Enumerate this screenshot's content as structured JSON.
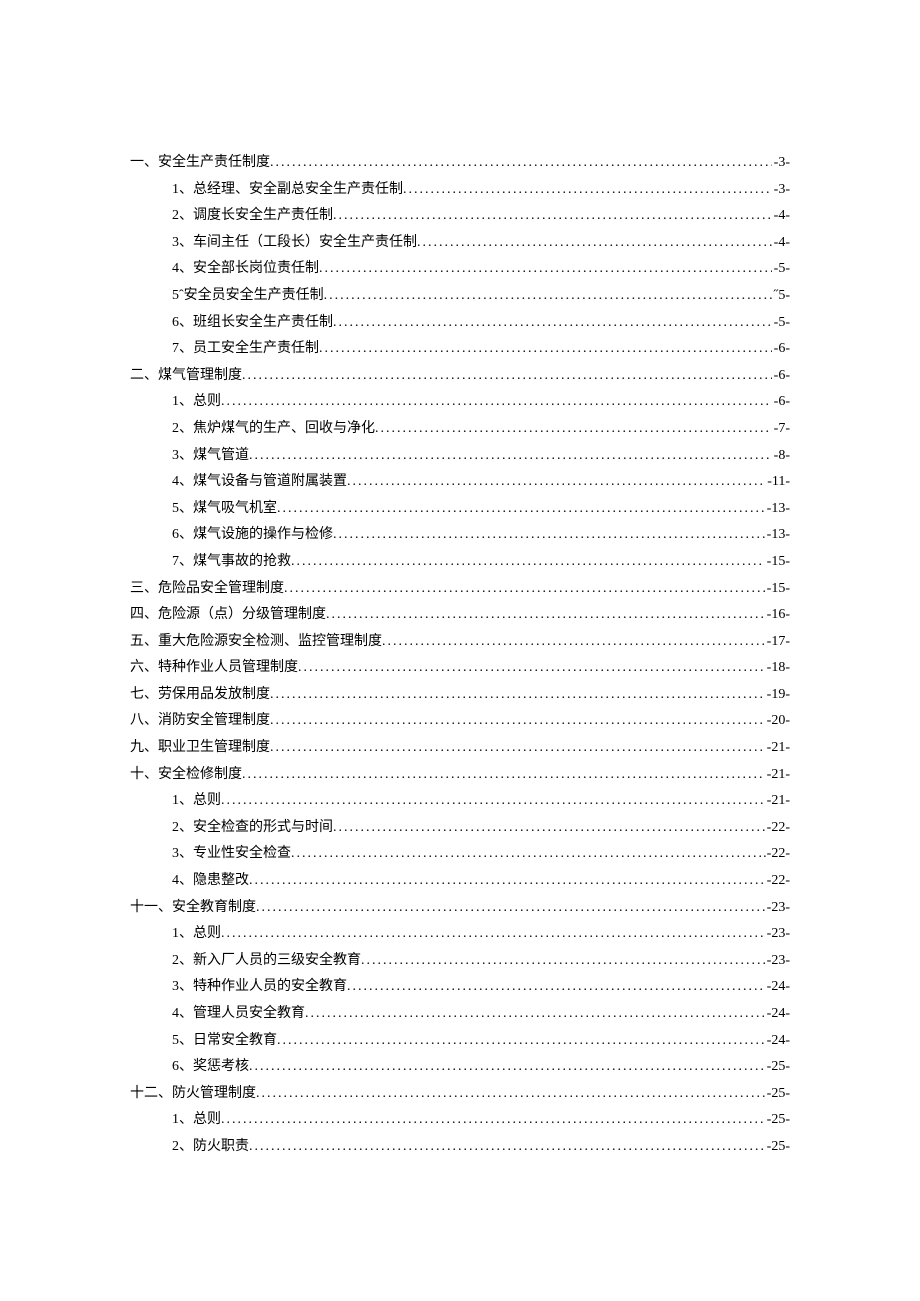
{
  "toc": [
    {
      "level": 0,
      "label": "一、安全生产责任制度",
      "page": "-3-"
    },
    {
      "level": 1,
      "label": "1、总经理、安全副总安全生产责任制",
      "page": "-3-"
    },
    {
      "level": 1,
      "label": "2、调度长安全生产责任制",
      "page": "-4-"
    },
    {
      "level": 1,
      "label": "3、车间主任（工段长）安全生产责任制",
      "page": "-4-"
    },
    {
      "level": 1,
      "label": "4、安全部长岗位责任制",
      "page": "-5-"
    },
    {
      "level": 1,
      "label": "5ˆ安全员安全生产责任制",
      "page": "˝5-"
    },
    {
      "level": 1,
      "label": "6、班组长安全生产责任制",
      "page": "-5-"
    },
    {
      "level": 1,
      "label": "7、员工安全生产责任制",
      "page": "-6-"
    },
    {
      "level": 0,
      "label": "二、煤气管理制度",
      "page": "-6-"
    },
    {
      "level": 1,
      "label": "1、总则",
      "page": "-6-"
    },
    {
      "level": 1,
      "label": "2、焦炉煤气的生产、回收与净化",
      "page": "-7-"
    },
    {
      "level": 1,
      "label": "3、煤气管道",
      "page": "-8-"
    },
    {
      "level": 1,
      "label": "4、煤气设备与管道附属装置",
      "page": "-11-"
    },
    {
      "level": 1,
      "label": "5、煤气吸气机室",
      "page": "-13-"
    },
    {
      "level": 1,
      "label": "6、煤气设施的操作与检修",
      "page": "-13-"
    },
    {
      "level": 1,
      "label": "7、煤气事故的抢救",
      "page": "-15-"
    },
    {
      "level": 0,
      "label": "三、危险品安全管理制度",
      "page": "-15-"
    },
    {
      "level": 0,
      "label": "四、危险源（点）分级管理制度",
      "page": "-16-"
    },
    {
      "level": 0,
      "label": "五、重大危险源安全检测、监控管理制度",
      "page": "-17-"
    },
    {
      "level": 0,
      "label": "六、特种作业人员管理制度",
      "page": "-18-"
    },
    {
      "level": 0,
      "label": "七、劳保用品发放制度",
      "page": "-19-"
    },
    {
      "level": 0,
      "label": "八、消防安全管理制度",
      "page": "-20-"
    },
    {
      "level": 0,
      "label": "九、职业卫生管理制度",
      "page": "-21-"
    },
    {
      "level": 0,
      "label": "十、安全检修制度",
      "page": "-21-"
    },
    {
      "level": 1,
      "label": "1、总则",
      "page": "-21-"
    },
    {
      "level": 1,
      "label": "2、安全检查的形式与时间",
      "page": "-22-"
    },
    {
      "level": 1,
      "label": "3、专业性安全检查",
      "page": ".-22-"
    },
    {
      "level": 1,
      "label": "4、隐患整改",
      "page": "-22-"
    },
    {
      "level": 0,
      "label": "十一、安全教育制度",
      "page": "-23-"
    },
    {
      "level": 1,
      "label": "1、总则",
      "page": "-23-"
    },
    {
      "level": 1,
      "label": "2、新入厂人员的三级安全教育",
      "page": "-23-"
    },
    {
      "level": 1,
      "label": "3、特种作业人员的安全教育",
      "page": "-24-"
    },
    {
      "level": 1,
      "label": "4、管理人员安全教育",
      "page": "-24-"
    },
    {
      "level": 1,
      "label": "5、日常安全教育",
      "page": "-24-"
    },
    {
      "level": 1,
      "label": "6、奖惩考核",
      "page": "-25-"
    },
    {
      "level": 0,
      "label": "十二、防火管理制度",
      "page": "-25-"
    },
    {
      "level": 1,
      "label": "1、总则",
      "page": "-25-"
    },
    {
      "level": 1,
      "label": "2、防火职责",
      "page": "-25-"
    }
  ]
}
